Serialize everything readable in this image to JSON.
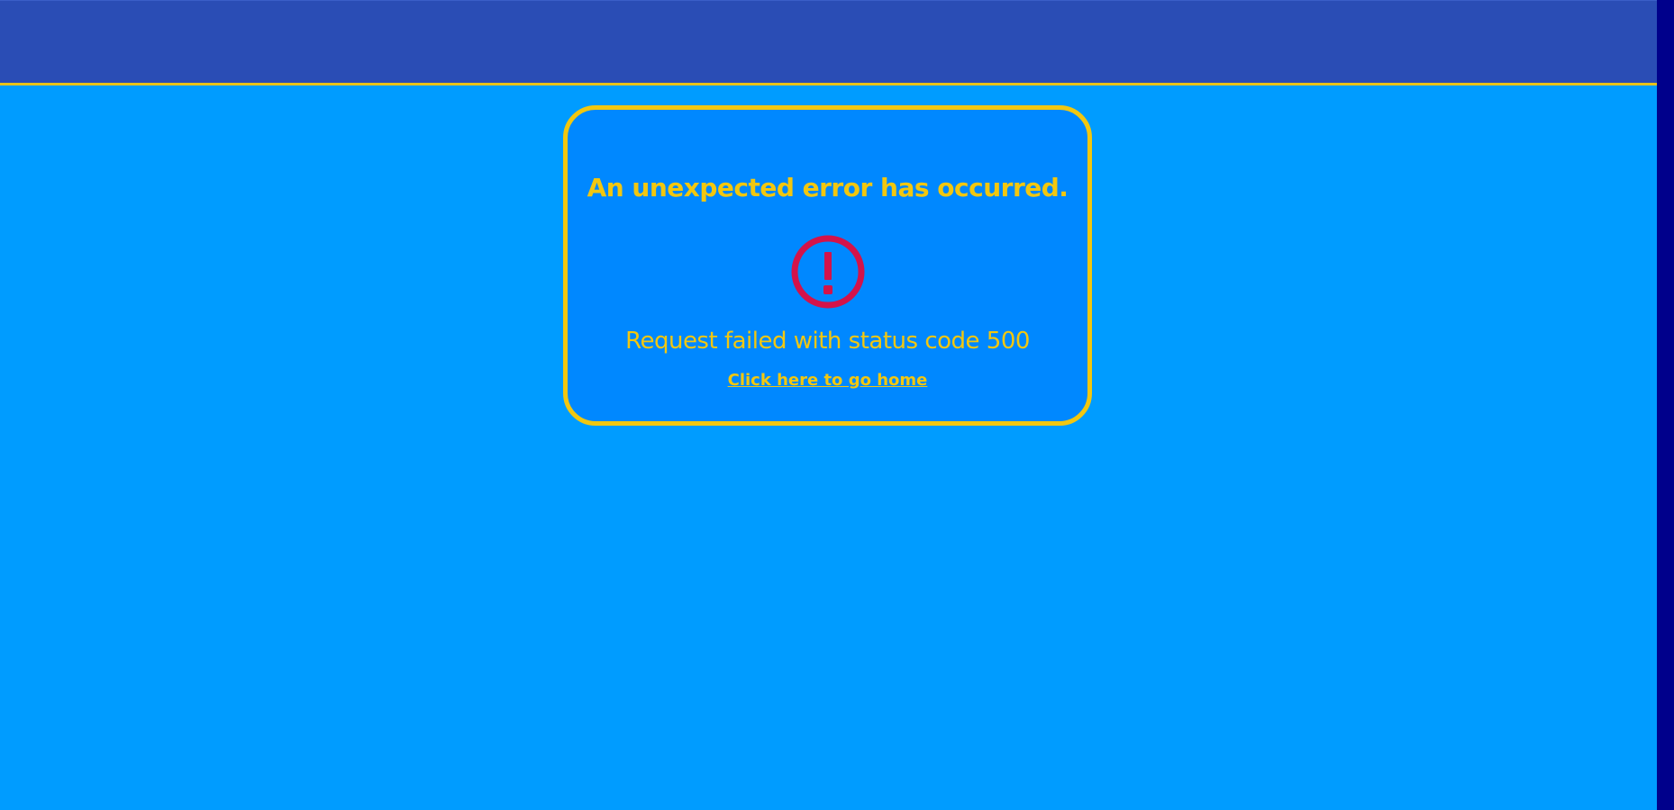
{
  "error": {
    "title": "An unexpected error has occurred.",
    "icon": "exclamation-circle-icon",
    "message": "Request failed with status code 500",
    "home_link": "Click here to go home"
  },
  "colors": {
    "background": "#009cff",
    "header": "#2a4db5",
    "accent": "#f2c70f",
    "card": "#0088ff",
    "icon": "#d3134a",
    "scrollbar": "#00008b"
  }
}
